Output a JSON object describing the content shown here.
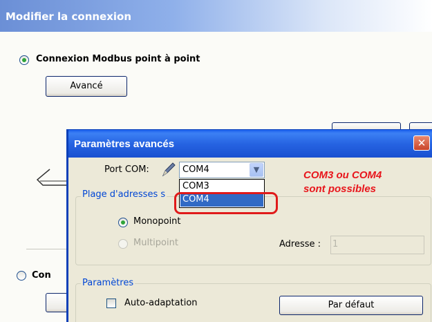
{
  "background_window": {
    "title": "Modifier la connexion",
    "radio_point_a_point": "Connexion Modbus point à point",
    "button_avance": "Avancé",
    "radio_second_partial": "Con"
  },
  "dialog": {
    "title": "Paramètres avancés",
    "port_com_label": "Port COM:",
    "combo_value": "COM4",
    "dropdown_options": [
      "COM3",
      "COM4"
    ],
    "dropdown_selected": "COM4",
    "group_addresses_label": "Plage d'adresses s",
    "radio_monopoint": "Monopoint",
    "radio_multipoint": "Multipoint",
    "adresse_label": "Adresse :",
    "adresse_value": "1",
    "group_parametres_label": "Paramètres",
    "checkbox_auto": "Auto-adaptation",
    "button_defaut": "Par défaut"
  },
  "annotation": {
    "line1": "COM3 ou COM4",
    "line2": "sont possibles"
  },
  "colors": {
    "annotation_red": "#e8161c",
    "selection_blue": "#316ac5",
    "title_blue": "#2664e2"
  }
}
